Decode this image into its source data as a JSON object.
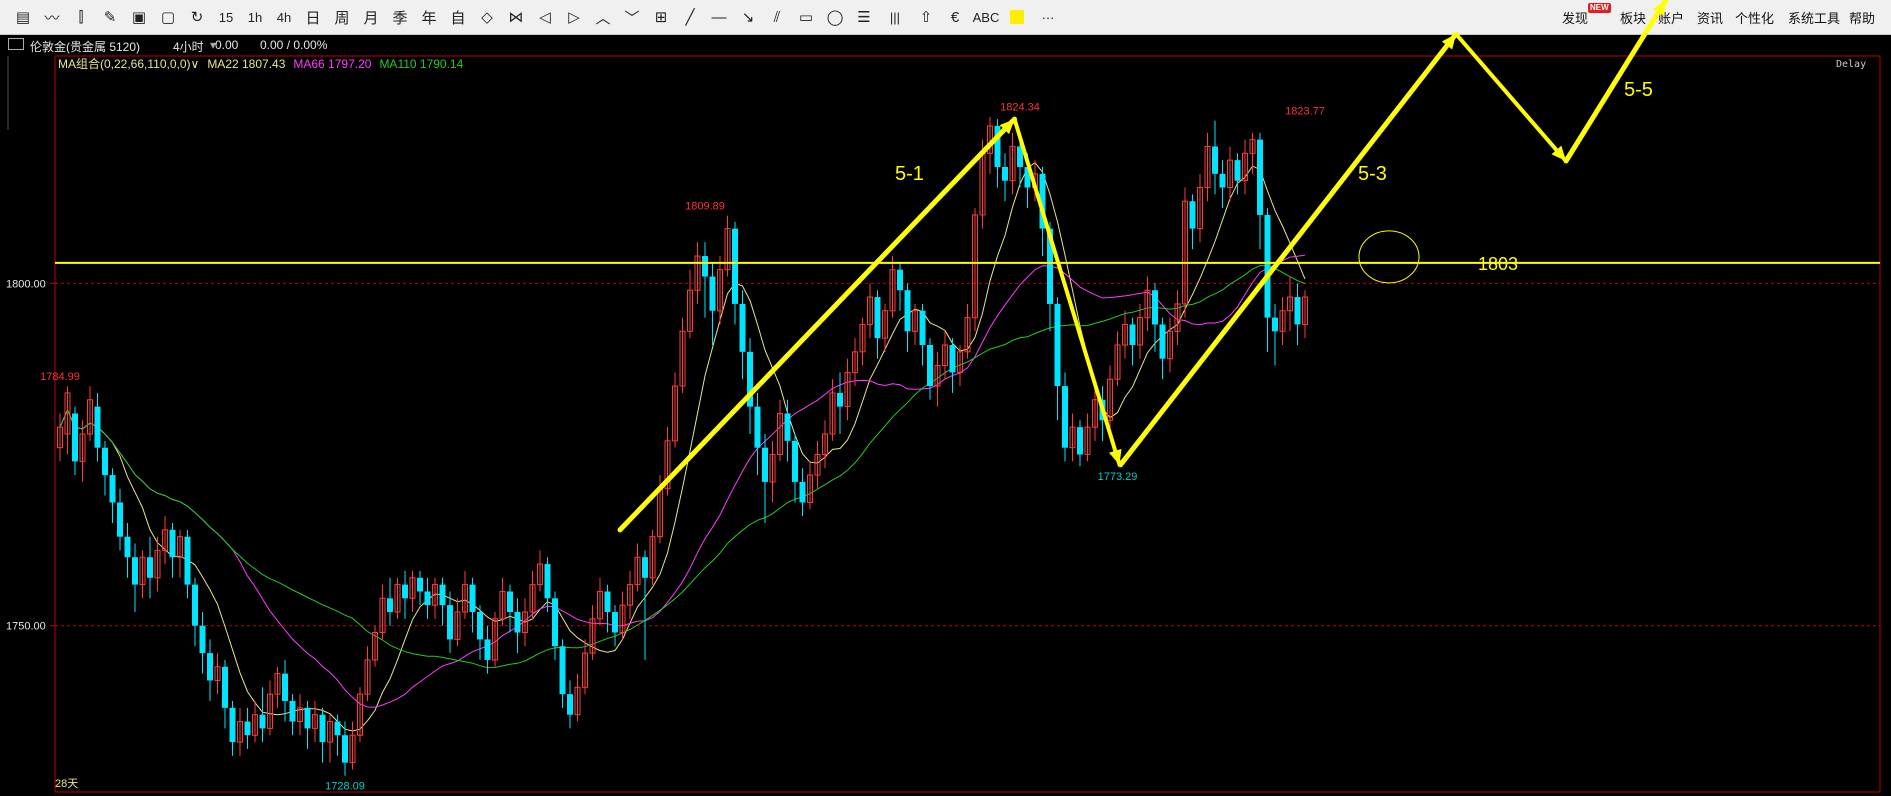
{
  "toolbar": {
    "icons": [
      {
        "name": "report-icon",
        "glyph": "▤"
      },
      {
        "name": "line-chart-icon",
        "glyph": "〰"
      },
      {
        "name": "candlestick-icon",
        "glyph": "⫿"
      },
      {
        "name": "draw-tool-icon",
        "glyph": "✎"
      },
      {
        "name": "f10-icon",
        "glyph": "▣"
      },
      {
        "name": "save-icon",
        "glyph": "▢"
      },
      {
        "name": "refresh-icon",
        "glyph": "↻"
      },
      {
        "name": "period-15",
        "glyph": "15"
      },
      {
        "name": "period-1h",
        "glyph": "1h"
      },
      {
        "name": "period-4h",
        "glyph": "4h"
      },
      {
        "name": "period-day",
        "glyph": "日"
      },
      {
        "name": "period-week",
        "glyph": "周"
      },
      {
        "name": "period-month",
        "glyph": "月"
      },
      {
        "name": "period-season",
        "glyph": "季"
      },
      {
        "name": "period-year",
        "glyph": "年"
      },
      {
        "name": "period-custom",
        "glyph": "自"
      },
      {
        "name": "zoom-in-icon",
        "glyph": "◇"
      },
      {
        "name": "zoom-out-icon",
        "glyph": "⋈"
      },
      {
        "name": "left-icon",
        "glyph": "◁"
      },
      {
        "name": "right-icon",
        "glyph": "▷"
      },
      {
        "name": "up-icon",
        "glyph": "︿"
      },
      {
        "name": "down-icon",
        "glyph": "﹀"
      },
      {
        "name": "layout-icon",
        "glyph": "⊞"
      },
      {
        "name": "line-tool-icon",
        "glyph": "╱"
      },
      {
        "name": "hline-tool-icon",
        "glyph": "—"
      },
      {
        "name": "ray-tool-icon",
        "glyph": "↘"
      },
      {
        "name": "parallel-tool-icon",
        "glyph": "⫽"
      },
      {
        "name": "rect-tool-icon",
        "glyph": "▭"
      },
      {
        "name": "ellipse-tool-icon",
        "glyph": "◯"
      },
      {
        "name": "fib-tool-icon",
        "glyph": "☰"
      },
      {
        "name": "gann-tool-icon",
        "glyph": "|||"
      },
      {
        "name": "arrow-tool-icon",
        "glyph": "⇧"
      },
      {
        "name": "fork-tool-icon",
        "glyph": "€"
      },
      {
        "name": "text-tool-icon",
        "glyph": "ABC"
      },
      {
        "name": "color-tool-icon",
        "glyph": ""
      },
      {
        "name": "more-icon",
        "glyph": "···"
      }
    ],
    "menus": [
      "发现",
      "板块",
      "账户",
      "资讯",
      "个性化",
      "系统工具",
      "帮助"
    ],
    "new_badge": "NEW"
  },
  "infobar": {
    "symbol": "伦敦金(贵金属 5120)",
    "period": "4小时",
    "price": "0.00",
    "change": "0.00 / 0.00%",
    "delay": "Delay"
  },
  "ma": {
    "group": "MA组合(0,22,66,110,0,0)",
    "ma22": "MA22 1807.43",
    "ma66": "MA66 1797.20",
    "ma110": "MA110 1790.14"
  },
  "colors": {
    "up": "#ff3b3b",
    "down": "#00e4ff",
    "ma22": "#e6e68c",
    "ma66": "#ff3cff",
    "ma110": "#22cc22",
    "annot": "#ffff00",
    "axis": "#c00000",
    "price_label": "#ff3333",
    "low_label": "#00cccc"
  },
  "axis": {
    "tick_1800": "1800.00",
    "tick_1750": "1750.00",
    "days_label": "28天"
  },
  "chart_data": {
    "type": "candlestick",
    "ylim": [
      1726,
      1830
    ],
    "y_ticks": [
      1750,
      1800
    ],
    "peak_labels": [
      {
        "index": 0,
        "value": 1784.99,
        "label": "1784.99"
      },
      {
        "index": 38,
        "value": 1728.09,
        "label": "1728.09"
      },
      {
        "index": 86,
        "value": 1809.89,
        "label": "1809.89"
      },
      {
        "index": 128,
        "value": 1824.34,
        "label": "1824.34"
      },
      {
        "index": 141,
        "value": 1773.29,
        "label": "1773.29"
      },
      {
        "index": 166,
        "value": 1823.77,
        "label": "1823.77"
      }
    ],
    "annotations": {
      "level": 1803,
      "level_label": "1803",
      "wave_labels": [
        "5-1",
        "5-3",
        "5-5"
      ]
    },
    "candles": [
      [
        1776,
        1779,
        1781,
        1774
      ],
      [
        1778,
        1784,
        1785,
        1775
      ],
      [
        1781,
        1774,
        1782,
        1772
      ],
      [
        1774,
        1778,
        1780,
        1771
      ],
      [
        1778,
        1783,
        1784.99,
        1777
      ],
      [
        1782,
        1776,
        1784,
        1774
      ],
      [
        1776,
        1772,
        1777,
        1769
      ],
      [
        1772,
        1768,
        1773,
        1765
      ],
      [
        1768,
        1763,
        1770,
        1761
      ],
      [
        1763,
        1760,
        1765,
        1757
      ],
      [
        1760,
        1756,
        1762,
        1752
      ],
      [
        1756,
        1760,
        1761,
        1754
      ],
      [
        1760,
        1757,
        1763,
        1754
      ],
      [
        1757,
        1761,
        1763,
        1755
      ],
      [
        1761,
        1764,
        1766,
        1759
      ],
      [
        1764,
        1760,
        1765,
        1757
      ],
      [
        1760,
        1763,
        1764,
        1757
      ],
      [
        1763,
        1756,
        1764,
        1754
      ],
      [
        1756,
        1750,
        1757,
        1747
      ],
      [
        1750,
        1746,
        1752,
        1743
      ],
      [
        1746,
        1742,
        1748,
        1739
      ],
      [
        1742,
        1744,
        1746,
        1740
      ],
      [
        1744,
        1738,
        1745,
        1735
      ],
      [
        1738,
        1733,
        1739,
        1731
      ],
      [
        1733,
        1736,
        1738,
        1731
      ],
      [
        1736,
        1734,
        1738,
        1732
      ],
      [
        1734,
        1737,
        1739,
        1733
      ],
      [
        1737,
        1735,
        1741,
        1733
      ],
      [
        1735,
        1740,
        1742,
        1734
      ],
      [
        1740,
        1743,
        1744,
        1738
      ],
      [
        1743,
        1739,
        1745,
        1736
      ],
      [
        1739,
        1736,
        1740,
        1734
      ],
      [
        1736,
        1738,
        1740,
        1734
      ],
      [
        1738,
        1735,
        1739,
        1732
      ],
      [
        1735,
        1737,
        1739,
        1733
      ],
      [
        1737,
        1733,
        1738,
        1730
      ],
      [
        1733,
        1736,
        1737,
        1730
      ],
      [
        1736,
        1734,
        1737,
        1731
      ],
      [
        1734,
        1730,
        1736,
        1728.09
      ],
      [
        1730,
        1734,
        1736,
        1729
      ],
      [
        1734,
        1740,
        1741,
        1733
      ],
      [
        1740,
        1745,
        1747,
        1739
      ],
      [
        1745,
        1749,
        1750,
        1744
      ],
      [
        1749,
        1754,
        1756,
        1748
      ],
      [
        1754,
        1752,
        1757,
        1750
      ],
      [
        1752,
        1756,
        1757,
        1751
      ],
      [
        1756,
        1754,
        1758,
        1751
      ],
      [
        1754,
        1757,
        1758,
        1752
      ],
      [
        1757,
        1755,
        1758,
        1753
      ],
      [
        1755,
        1753,
        1757,
        1751
      ],
      [
        1753,
        1756,
        1757,
        1751
      ],
      [
        1756,
        1753,
        1757,
        1750
      ],
      [
        1753,
        1748,
        1755,
        1746
      ],
      [
        1748,
        1752,
        1754,
        1747
      ],
      [
        1752,
        1756,
        1758,
        1751
      ],
      [
        1756,
        1752,
        1757,
        1749
      ],
      [
        1752,
        1748,
        1753,
        1745
      ],
      [
        1748,
        1745,
        1750,
        1743
      ],
      [
        1745,
        1751,
        1752,
        1744
      ],
      [
        1751,
        1755,
        1757,
        1750
      ],
      [
        1755,
        1752,
        1756,
        1749
      ],
      [
        1752,
        1749,
        1754,
        1746
      ],
      [
        1749,
        1752,
        1754,
        1747
      ],
      [
        1752,
        1756,
        1758,
        1751
      ],
      [
        1756,
        1759,
        1761,
        1755
      ],
      [
        1759,
        1754,
        1760,
        1752
      ],
      [
        1754,
        1747,
        1755,
        1745
      ],
      [
        1747,
        1740,
        1748,
        1738
      ],
      [
        1740,
        1737,
        1742,
        1735
      ],
      [
        1737,
        1741,
        1743,
        1736
      ],
      [
        1741,
        1746,
        1748,
        1740
      ],
      [
        1746,
        1751,
        1753,
        1745
      ],
      [
        1751,
        1755,
        1757,
        1750
      ],
      [
        1755,
        1752,
        1756,
        1749
      ],
      [
        1752,
        1749,
        1753,
        1747
      ],
      [
        1749,
        1753,
        1755,
        1748
      ],
      [
        1753,
        1756,
        1758,
        1751
      ],
      [
        1756,
        1760,
        1762,
        1755
      ],
      [
        1760,
        1757,
        1761,
        1745
      ],
      [
        1757,
        1763,
        1764,
        1756
      ],
      [
        1763,
        1770,
        1772,
        1762
      ],
      [
        1770,
        1777,
        1779,
        1769
      ],
      [
        1777,
        1785,
        1787,
        1776
      ],
      [
        1785,
        1793,
        1795,
        1784
      ],
      [
        1793,
        1799,
        1802,
        1792
      ],
      [
        1799,
        1804,
        1806,
        1797
      ],
      [
        1804,
        1801,
        1806,
        1795
      ],
      [
        1801,
        1796,
        1803,
        1791
      ],
      [
        1796,
        1802,
        1804,
        1794
      ],
      [
        1802,
        1808,
        1809.89,
        1801
      ],
      [
        1808,
        1797,
        1809,
        1794
      ],
      [
        1797,
        1790,
        1799,
        1786
      ],
      [
        1790,
        1782,
        1792,
        1778
      ],
      [
        1782,
        1776,
        1784,
        1772
      ],
      [
        1776,
        1771,
        1778,
        1765
      ],
      [
        1771,
        1775,
        1777,
        1768
      ],
      [
        1775,
        1781,
        1783,
        1774
      ],
      [
        1781,
        1777,
        1783,
        1774
      ],
      [
        1777,
        1771,
        1778,
        1768
      ],
      [
        1771,
        1768,
        1773,
        1766
      ],
      [
        1768,
        1772,
        1774,
        1767
      ],
      [
        1772,
        1775,
        1777,
        1770
      ],
      [
        1775,
        1778,
        1780,
        1773
      ],
      [
        1778,
        1784,
        1786,
        1777
      ],
      [
        1784,
        1782,
        1787,
        1778
      ],
      [
        1782,
        1787,
        1789,
        1780
      ],
      [
        1787,
        1790,
        1792,
        1785
      ],
      [
        1790,
        1794,
        1795,
        1788
      ],
      [
        1794,
        1798,
        1800,
        1792
      ],
      [
        1798,
        1792,
        1799,
        1789
      ],
      [
        1792,
        1796,
        1797,
        1790
      ],
      [
        1796,
        1802,
        1804,
        1795
      ],
      [
        1802,
        1799,
        1803,
        1796
      ],
      [
        1799,
        1793,
        1800,
        1790
      ],
      [
        1793,
        1796,
        1797,
        1791
      ],
      [
        1796,
        1791,
        1797,
        1788
      ],
      [
        1791,
        1785,
        1792,
        1783
      ],
      [
        1785,
        1788,
        1790,
        1782
      ],
      [
        1788,
        1791,
        1793,
        1786
      ],
      [
        1791,
        1787,
        1792,
        1784
      ],
      [
        1787,
        1790,
        1791,
        1785
      ],
      [
        1790,
        1795,
        1797,
        1789
      ],
      [
        1795,
        1810,
        1811,
        1793
      ],
      [
        1810,
        1819,
        1821,
        1808
      ],
      [
        1819,
        1823,
        1824.34,
        1816
      ],
      [
        1823,
        1817,
        1824,
        1814
      ],
      [
        1817,
        1815,
        1819,
        1812
      ],
      [
        1815,
        1820,
        1822,
        1813
      ],
      [
        1820,
        1817,
        1821,
        1814
      ],
      [
        1817,
        1814,
        1819,
        1811
      ],
      [
        1814,
        1816,
        1818,
        1812
      ],
      [
        1816,
        1808,
        1817,
        1804
      ],
      [
        1808,
        1797,
        1809,
        1793
      ],
      [
        1797,
        1785,
        1798,
        1780
      ],
      [
        1785,
        1776,
        1787,
        1774
      ],
      [
        1776,
        1779,
        1781,
        1774
      ],
      [
        1779,
        1775,
        1780,
        1773.29
      ],
      [
        1775,
        1779,
        1781,
        1774
      ],
      [
        1779,
        1783,
        1785,
        1777
      ],
      [
        1783,
        1780,
        1785,
        1777
      ],
      [
        1780,
        1786,
        1788,
        1779
      ],
      [
        1786,
        1791,
        1793,
        1785
      ],
      [
        1791,
        1794,
        1796,
        1789
      ],
      [
        1794,
        1791,
        1795,
        1788
      ],
      [
        1791,
        1795,
        1797,
        1789
      ],
      [
        1795,
        1799,
        1801,
        1793
      ],
      [
        1799,
        1794,
        1800,
        1790
      ],
      [
        1794,
        1789,
        1795,
        1786
      ],
      [
        1789,
        1793,
        1795,
        1787
      ],
      [
        1793,
        1797,
        1799,
        1791
      ],
      [
        1797,
        1812,
        1814,
        1795
      ],
      [
        1812,
        1808,
        1813,
        1805
      ],
      [
        1808,
        1814,
        1816,
        1806
      ],
      [
        1814,
        1820,
        1822,
        1812
      ],
      [
        1820,
        1816,
        1823.77,
        1813
      ],
      [
        1816,
        1814,
        1818,
        1811
      ],
      [
        1814,
        1818,
        1820,
        1812
      ],
      [
        1818,
        1815,
        1819,
        1813
      ],
      [
        1815,
        1819,
        1821,
        1813
      ],
      [
        1819,
        1821,
        1822,
        1816
      ],
      [
        1821,
        1810,
        1822,
        1805
      ],
      [
        1810,
        1795,
        1811,
        1790
      ],
      [
        1795,
        1793,
        1797,
        1788
      ],
      [
        1793,
        1796,
        1798,
        1791
      ],
      [
        1796,
        1798,
        1801,
        1793
      ],
      [
        1798,
        1794,
        1800,
        1791
      ],
      [
        1794,
        1798,
        1799,
        1792
      ]
    ]
  }
}
